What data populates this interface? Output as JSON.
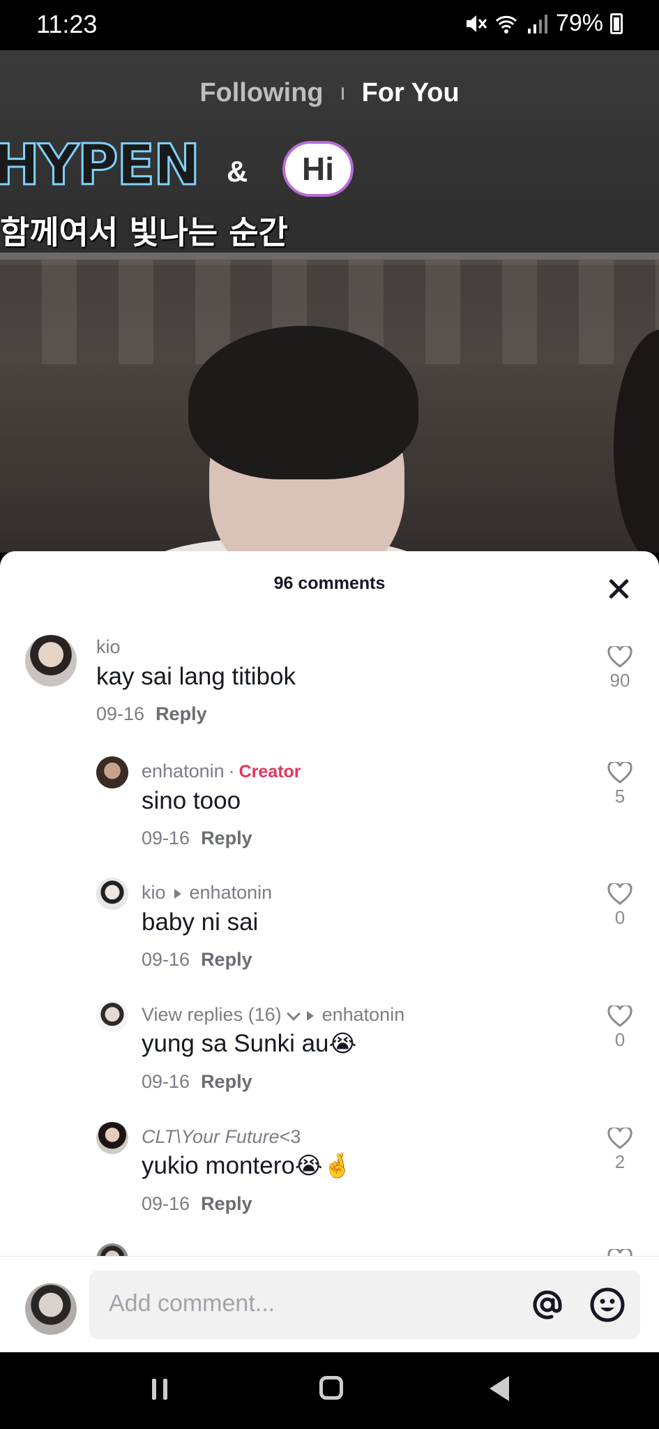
{
  "status_bar": {
    "time": "11:23",
    "battery": "79%",
    "icons": [
      "mute-icon",
      "wifi-icon",
      "signal-icon",
      "battery-icon"
    ]
  },
  "video": {
    "logo_text": "HYPEN",
    "logo_amp": "&",
    "logo_bubble": "Hi",
    "logo_subtitle": "함께여서 빛나는 순간"
  },
  "feed_tabs": [
    {
      "label": "Following",
      "active": false
    },
    {
      "label": "For You",
      "active": true
    }
  ],
  "comments_sheet": {
    "title": "96 comments",
    "comments": [
      {
        "user": "kio",
        "text": "kay sai lang titibok",
        "date": "09-16",
        "reply": "Reply",
        "likes": "90"
      },
      {
        "user": "enhatonin",
        "badge": "Creator",
        "text": "sino tooo",
        "date": "09-16",
        "reply": "Reply",
        "likes": "5"
      },
      {
        "user": "kio",
        "reply_to": "enhatonin",
        "text": "baby ni sai",
        "date": "09-16",
        "reply": "Reply",
        "likes": "0"
      },
      {
        "user": "View replies (16)",
        "reply_to": "enhatonin",
        "text": "yung sa Sunki au",
        "emoji": "😭",
        "date": "09-16",
        "reply": "Reply",
        "likes": "0"
      },
      {
        "user": "CLT\\Your Future",
        "user_suffix": "<3",
        "text": "yukio montero",
        "emoji": "😭🤞",
        "date": "09-16",
        "reply": "Reply",
        "likes": "2"
      }
    ]
  },
  "input_bar": {
    "placeholder": "Add comment...",
    "icons": [
      "at-icon",
      "emoji-icon"
    ]
  },
  "colors": {
    "creator_badge": "#e3355a",
    "text_primary": "#161823",
    "text_secondary": "#7b7d85"
  }
}
